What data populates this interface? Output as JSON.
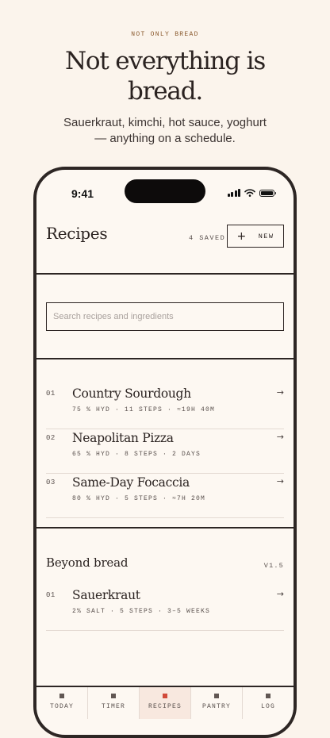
{
  "hero": {
    "eyebrow": "NOT ONLY BREAD",
    "title_line1": "Not everything is",
    "title_line2": "bread.",
    "subtitle_line1": "Sauerkraut, kimchi, hot sauce, yoghurt",
    "subtitle_line2": "— anything on a schedule."
  },
  "status": {
    "time": "9:41"
  },
  "header": {
    "title": "Recipes",
    "saved_count": "4 SAVED",
    "new_plus": "+",
    "new_label": "NEW"
  },
  "search": {
    "placeholder": "Search recipes and ingredients",
    "value": ""
  },
  "recipes": [
    {
      "num": "01",
      "name": "Country Sourdough",
      "meta": "75 % HYD · 11 STEPS · ≈19H 40M",
      "arrow": "→"
    },
    {
      "num": "02",
      "name": "Neapolitan Pizza",
      "meta": "65 % HYD · 8 STEPS · 2 DAYS",
      "arrow": "→"
    },
    {
      "num": "03",
      "name": "Same-Day Focaccia",
      "meta": "80 % HYD · 5 STEPS · ≈7H 20M",
      "arrow": "→"
    }
  ],
  "beyond": {
    "title": "Beyond bread",
    "version": "V1.5",
    "items": [
      {
        "num": "01",
        "name": "Sauerkraut",
        "meta": "2% SALT · 5 STEPS · 3–5 WEEKS",
        "arrow": "→"
      }
    ]
  },
  "tabs": [
    {
      "label": "TODAY",
      "active": false
    },
    {
      "label": "TIMER",
      "active": false
    },
    {
      "label": "RECIPES",
      "active": true
    },
    {
      "label": "PANTRY",
      "active": false
    },
    {
      "label": "LOG",
      "active": false
    }
  ],
  "colors": {
    "accent": "#d14a3a",
    "ink": "#2b2321",
    "background": "#fbf4ec"
  }
}
